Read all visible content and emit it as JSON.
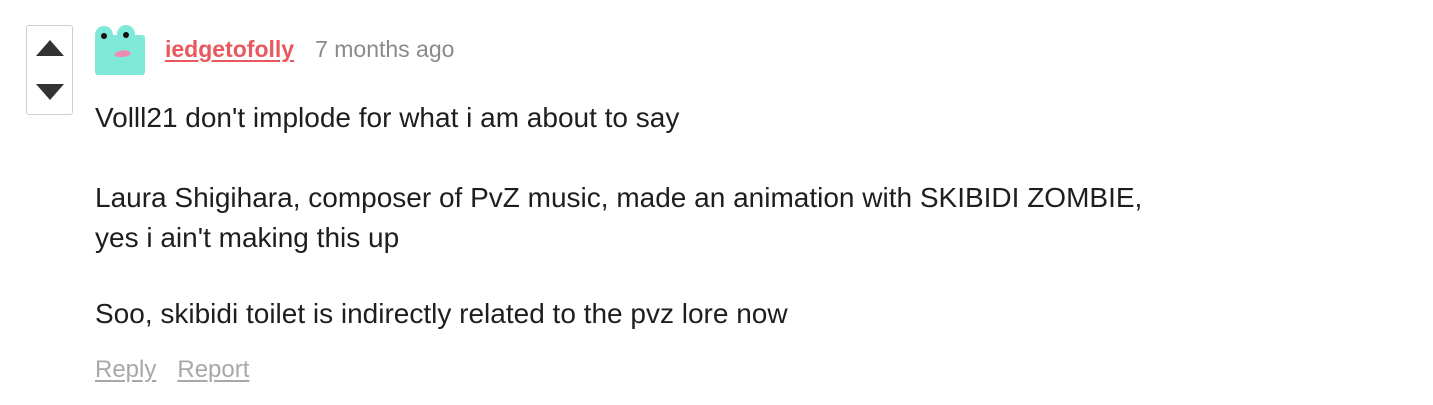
{
  "comment": {
    "author": "iedgetofolly",
    "timestamp": "7 months ago",
    "paragraphs": [
      "Volll21 don't implode for what i am about to say",
      "Laura Shigihara, composer of PvZ music, made an animation with SKIBIDI ZOMBIE,",
      "yes i ain't making this up",
      "Soo, skibidi toilet is indirectly related to the pvz lore now"
    ],
    "actions": {
      "reply": "Reply",
      "report": "Report"
    }
  },
  "colors": {
    "author": "#e8585c",
    "timestamp": "#8a8a8a",
    "body_text": "#1e1e1e",
    "action_links": "#a8a8a8",
    "avatar_bg": "#7fe8d8",
    "avatar_cheek": "#f08ab0",
    "vote_arrow": "#333333"
  },
  "icons": {
    "upvote": "triangle-up-icon",
    "downvote": "triangle-down-icon",
    "avatar": "frog-avatar-icon"
  }
}
